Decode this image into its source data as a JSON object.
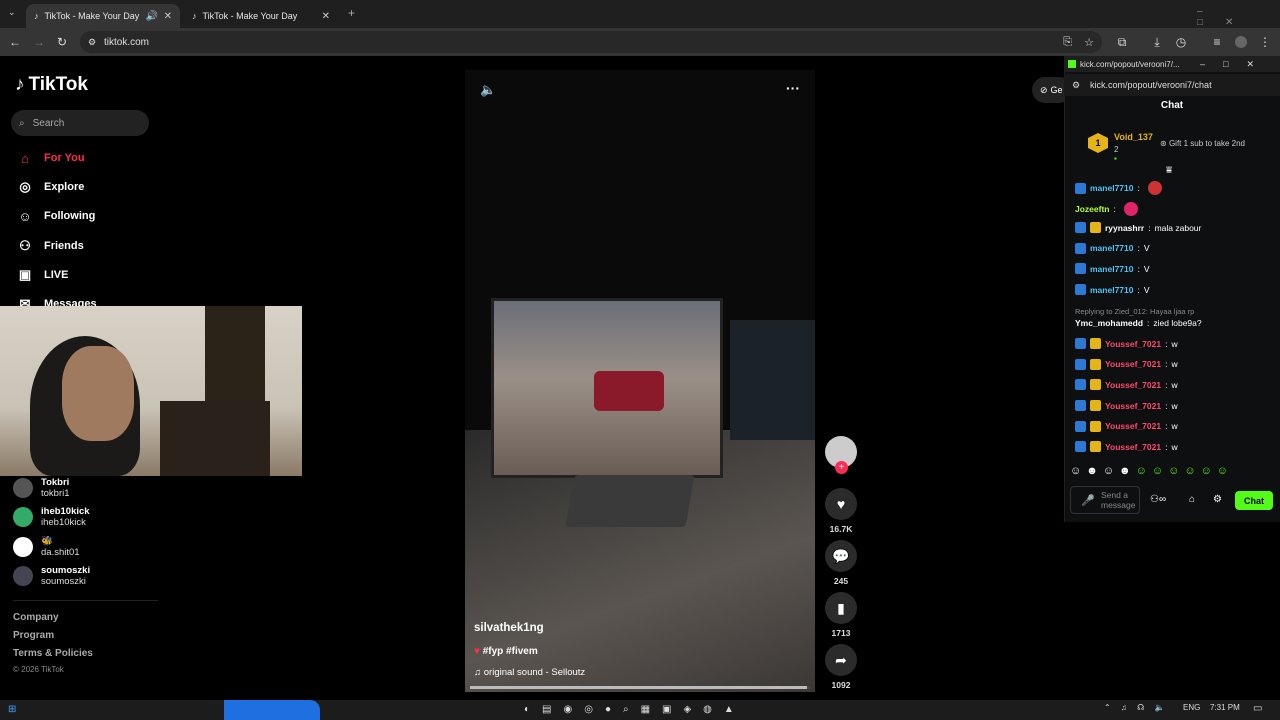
{
  "browser": {
    "tabs": [
      {
        "title": "TikTok - Make Your Day",
        "active": true
      },
      {
        "title": "TikTok - Make Your Day",
        "active": false
      }
    ],
    "url": "tiktok.com"
  },
  "tiktok": {
    "logo": "TikTok",
    "search_placeholder": "Search",
    "nav": [
      "For You",
      "Explore",
      "Following",
      "Friends",
      "LIVE",
      "Messages"
    ],
    "following": [
      {
        "name": "Tokbri",
        "handle": "tokbri1"
      },
      {
        "name": "iheb10kick",
        "handle": "iheb10kick"
      },
      {
        "name": "🐝",
        "handle": "da.shit01"
      },
      {
        "name": "soumoszki",
        "handle": "soumoszki"
      }
    ],
    "footer": [
      "Company",
      "Program",
      "Terms & Policies"
    ],
    "copyright": "© 2026 TikTok",
    "video": {
      "author": "silvathek1ng",
      "caption": "#fyp #fivem",
      "sound": "original sound - Selloutz",
      "likes": "16.7K",
      "comments": "245",
      "saves": "1713",
      "shares": "1092",
      "progress": 0.99
    },
    "get_app": "Ge"
  },
  "kick": {
    "title": "kick.com/popout/verooni7/...",
    "url": "kick.com/popout/verooni7/chat",
    "chat_title": "Chat",
    "gifter": {
      "rank": "1",
      "name": "Void_137",
      "count": "2",
      "note": "Gift 1 sub to take 2nd"
    },
    "messages": [
      {
        "user": "manel7710",
        "text": "",
        "color": "#4fc3f7"
      },
      {
        "user": "Jozeeftn",
        "text": "",
        "color": "#b6ff3b"
      },
      {
        "user": "ryynashrr",
        "text": "mala zabour",
        "color": "#ffffff"
      },
      {
        "user": "manel7710",
        "text": "V",
        "color": "#4fc3f7"
      },
      {
        "user": "manel7710",
        "text": "V",
        "color": "#4fc3f7"
      },
      {
        "user": "manel7710",
        "text": "V",
        "color": "#4fc3f7"
      },
      {
        "user": "Ymc_mohamedd",
        "text": "zied lobe9a?",
        "color": "#ffffff",
        "reply": "Replying to Zied_012: Hayaa ljaa rp"
      },
      {
        "user": "Youssef_7021",
        "text": "w",
        "color": "#ff4b6e"
      },
      {
        "user": "Youssef_7021",
        "text": "w",
        "color": "#ff4b6e"
      },
      {
        "user": "Youssef_7021",
        "text": "w",
        "color": "#ff4b6e"
      },
      {
        "user": "Youssef_7021",
        "text": "w",
        "color": "#ff4b6e"
      },
      {
        "user": "Youssef_7021",
        "text": "w",
        "color": "#ff4b6e"
      },
      {
        "user": "Youssef_7021",
        "text": "w",
        "color": "#ff4b6e"
      }
    ],
    "send_placeholder": "Send a message",
    "chat_button": "Chat",
    "accent": "#53fc18"
  },
  "taskbar": {
    "lang": "ENG",
    "time": "7:31 PM"
  },
  "colors": {
    "tiktok_red": "#fe2c55"
  }
}
